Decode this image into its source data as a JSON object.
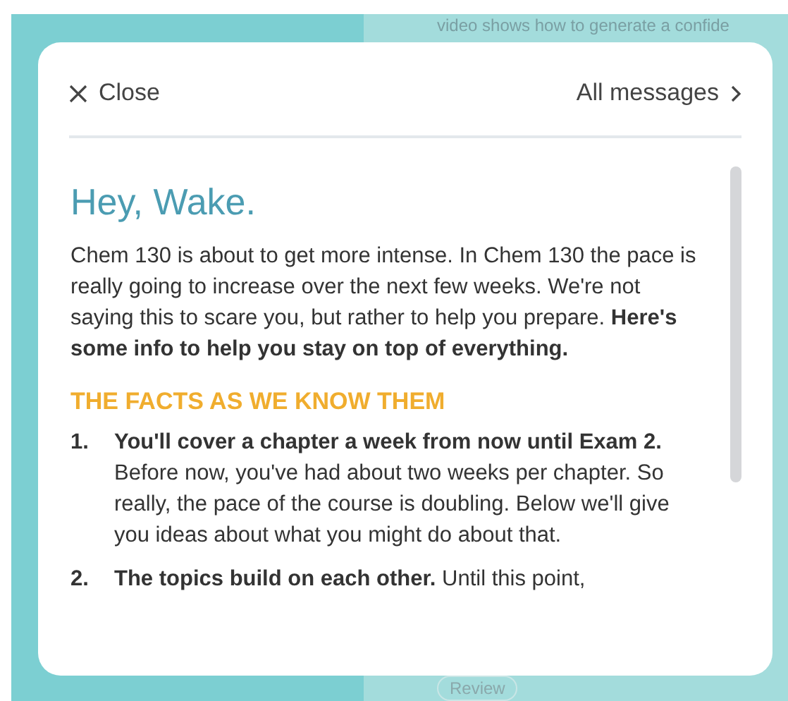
{
  "background": {
    "text": "video shows how to generate a confide",
    "button": "Review"
  },
  "modal": {
    "close": "Close",
    "all_messages": "All messages",
    "greeting": "Hey, Wake.",
    "intro": "Chem 130 is about to get more intense. In Chem 130 the pace is really going to increase over the next few weeks. We're not saying this to scare you, but rather to help you prepare. **Here's some info to help you stay on top of everything.**",
    "section_heading": "THE FACTS AS WE KNOW THEM",
    "items": [
      {
        "number": "1.",
        "text": "**You'll cover a chapter a week from now until Exam 2.** Before now, you've had about two weeks per chapter. So really, the pace of the course is doubling. Below we'll give you ideas about what you might do about that."
      },
      {
        "number": "2.",
        "text": "**The topics build on each other.** Until this point,"
      }
    ]
  }
}
